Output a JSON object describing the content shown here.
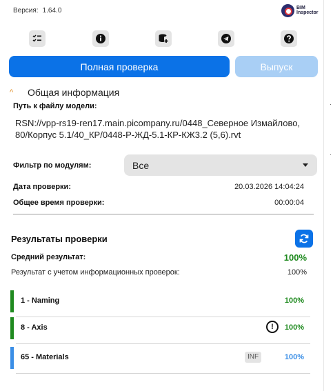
{
  "header": {
    "version_label": "Версия:",
    "version_value": "1.64.0",
    "logo_line1": "BIM",
    "logo_line2": "Inspector"
  },
  "toolbar": {
    "icons": [
      "checklist-icon",
      "info-icon",
      "database-add-icon",
      "telegram-icon",
      "help-icon"
    ]
  },
  "actions": {
    "full_check": "Полная проверка",
    "release": "Выпуск"
  },
  "general": {
    "section_title": "Общая информация",
    "path_label": "Путь к файлу модели:",
    "path_value": "RSN://vpp-rs19-ren17.main.picompany.ru/0448_Северное Измайлово, 80/Корпус 5.1/40_КР/0448-Р-ЖД-5.1-КР-КЖ3.2 (5,6).rvt",
    "filter_label": "Фильтр по модулям:",
    "filter_value": "Все",
    "check_date_label": "Дата проверки:",
    "check_date_value": "20.03.2026 14:04:24",
    "total_time_label": "Общее время проверки:",
    "total_time_value": "00:00:04"
  },
  "results": {
    "title": "Результаты проверки",
    "avg_label": "Средний результат:",
    "avg_value": "100%",
    "info_label": "Результат с учетом информационных проверок:",
    "info_value": "100%",
    "modules": [
      {
        "name": "1 - Naming",
        "value": "100%",
        "status_color": "#1f8a1f"
      },
      {
        "name": "8 - Axis",
        "value": "100%",
        "status_color": "#1f8a1f",
        "warning": "!"
      },
      {
        "name": "65 - Materials",
        "value": "100%",
        "status_color": "#3a8ee6",
        "badge": "INF"
      }
    ]
  },
  "colors": {
    "primary": "#0b72e7",
    "primary_disabled": "#a9cff5",
    "success": "#1f8a1f",
    "info": "#3a8ee6",
    "accent": "#e08a1e"
  }
}
